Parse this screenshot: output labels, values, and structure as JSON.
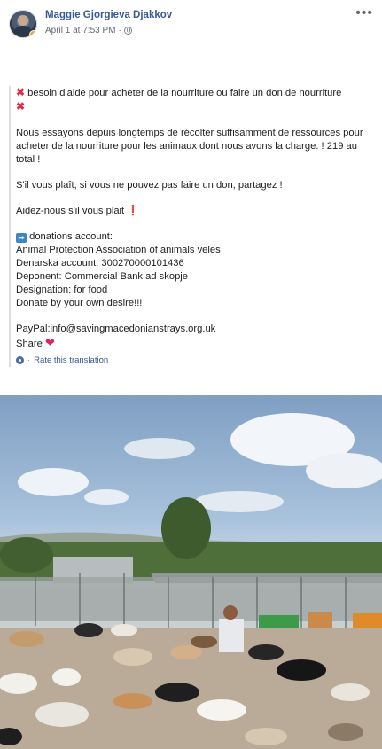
{
  "post": {
    "author": "Maggie Gjorgieva Djakkov",
    "timestamp": "April 1 at 7:53 PM",
    "privacy_icon": "globe-icon",
    "more_icon": "more-options-icon"
  },
  "body": {
    "line1": "besoin d'aide pour acheter de la nourriture ou faire un don de nourriture",
    "para2": "Nous essayons depuis longtemps de récolter suffisamment de ressources pour acheter de la nourriture pour les animaux dont nous avons la charge. ! 219 au total !",
    "para3": "S'il vous plaît, si vous ne pouvez pas faire un don, partagez !",
    "para4": "Aidez-nous s'il vous plait",
    "donations_header": "donations account:",
    "donations_lines": [
      "Animal Protection Association of animals veles",
      "Denarska account: 300270000101436",
      "Deponent: Commercial Bank ad skopje",
      "Designation: for food",
      "Donate by your own desire!!!"
    ],
    "paypal": "PayPal:info@savingmacedonianstrays.org.uk",
    "share": "Share"
  },
  "translation": {
    "separator": "·",
    "label": "Rate this translation"
  },
  "colors": {
    "link": "#385898",
    "text": "#1c1e21",
    "meta": "#616770",
    "red_mark": "#dd2e44",
    "heart": "#e0245e"
  }
}
